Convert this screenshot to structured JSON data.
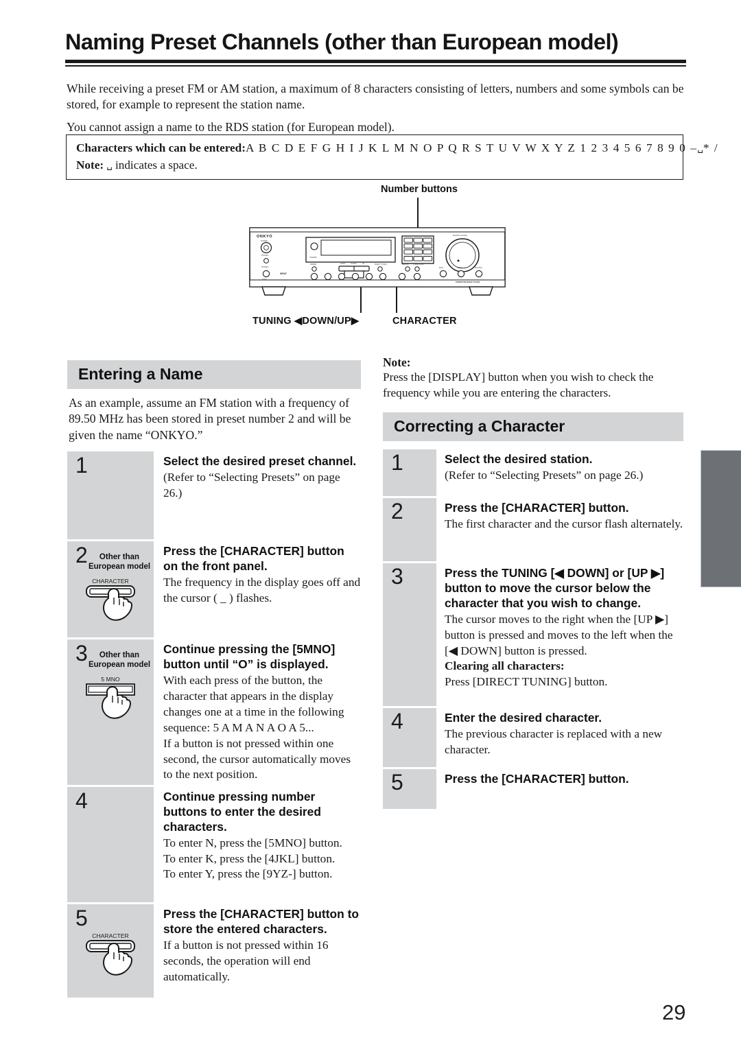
{
  "document": {
    "title": "Naming Preset Channels (other than European model)",
    "page_number": "29"
  },
  "intro": {
    "p1": "While receiving a preset FM or AM station, a maximum of 8 characters consisting of letters, numbers and some symbols can be stored, for example to represent the station name.",
    "p2": "You cannot assign a name to the RDS station (for European model)."
  },
  "character_box": {
    "label": "Characters which can be entered:",
    "characters": "A B C D E F G H I J K L M N O P Q R S T U V W X Y Z 1 2 3 4 5 6 7 8 9 0 –",
    "trailing": "* /",
    "note_label": "Note:",
    "note_text": "indicates a space.",
    "space_glyph": "␣"
  },
  "diagram": {
    "label_number_buttons": "Number buttons",
    "label_tuning": "TUNING ◀DOWN/UP▶",
    "label_character": "CHARACTER",
    "brand": "ONKYO"
  },
  "entering_a_name": {
    "heading": "Entering a Name",
    "lead": "As an example, assume an FM station with a frequency of 89.50 MHz has been stored in preset number 2 and will be given the name “ONKYO.”",
    "steps": [
      {
        "num": "1",
        "title": "Select the desired preset channel.",
        "text": "(Refer to “Selecting Presets” on page 26.)"
      },
      {
        "num": "2",
        "badge": "Other than European model",
        "button_label": "CHARACTER",
        "title": "Press the [CHARACTER] button on the front panel.",
        "text": "The frequency in the display goes off and the cursor ( _ ) flashes."
      },
      {
        "num": "3",
        "badge": "Other than European model",
        "button_label": "5 MNO",
        "title": "Continue pressing the [5MNO] button until “O” is displayed.",
        "text": "With each press of the button, the character that appears in the display changes one at a time in the following sequence: 5  A M  A N  A O  A 5...",
        "text2": "If a button is not pressed within one second, the cursor automatically moves to the next position."
      },
      {
        "num": "4",
        "title": "Continue pressing number buttons to enter the desired characters.",
        "text": "To enter N, press the [5MNO] button.",
        "text2": "To enter K, press the [4JKL] button.",
        "text3": "To enter Y, press the [9YZ-] button."
      },
      {
        "num": "5",
        "button_label": "CHARACTER",
        "title": "Press the [CHARACTER] button to store the entered characters.",
        "text": "If a button is not pressed within 16 seconds, the operation will end automatically."
      }
    ]
  },
  "note": {
    "label": "Note:",
    "text": "Press the [DISPLAY] button when you wish to check the frequency while you are entering the characters."
  },
  "correcting_a_character": {
    "heading": "Correcting a Character",
    "steps": [
      {
        "num": "1",
        "title": "Select the desired station.",
        "text": "(Refer to “Selecting Presets” on page 26.)"
      },
      {
        "num": "2",
        "title": "Press the [CHARACTER] button.",
        "text": "The first character and the cursor flash alternately."
      },
      {
        "num": "3",
        "title": "Press the TUNING [◀ DOWN] or [UP ▶] button to move the cursor below the character that you wish to change.",
        "text": "The cursor moves to the right when the [UP ▶] button is pressed and moves to the left when the [◀ DOWN] button is pressed.",
        "subhead": "Clearing all characters:",
        "text2": "Press [DIRECT TUNING] button."
      },
      {
        "num": "4",
        "title": "Enter the desired character.",
        "text": "The previous character is replaced with a new character."
      },
      {
        "num": "5",
        "title": "Press the [CHARACTER] button."
      }
    ]
  },
  "colors": {
    "step_gray": "#d2d4d5",
    "tab_gray": "#6d7075",
    "text": "#1a1a1a"
  }
}
